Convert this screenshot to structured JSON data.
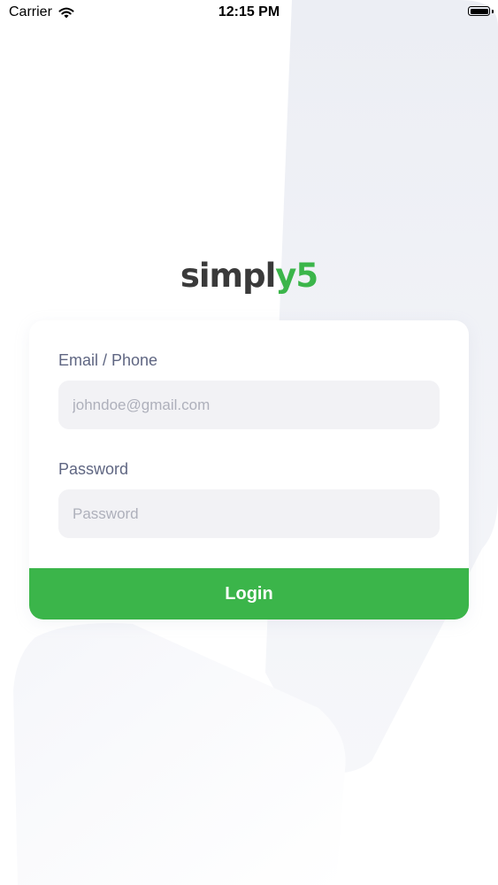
{
  "status_bar": {
    "carrier": "Carrier",
    "time": "12:15 PM"
  },
  "logo": {
    "dark_text": "simpl",
    "green_text": "y5"
  },
  "login_form": {
    "email_label": "Email / Phone",
    "email_placeholder": "johndoe@gmail.com",
    "password_label": "Password",
    "password_placeholder": "Password",
    "login_button_label": "Login"
  },
  "colors": {
    "accent_green": "#3bb54a",
    "logo_dark": "#3a3a3a",
    "label_text": "#5f6682",
    "input_background": "#f2f2f5"
  }
}
